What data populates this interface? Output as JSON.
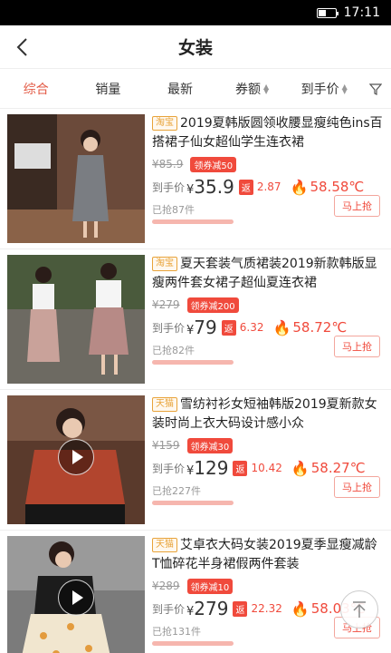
{
  "status": {
    "time": "17:11"
  },
  "header": {
    "title": "女装"
  },
  "sort": {
    "items": [
      "综合",
      "销量",
      "最新",
      "券额",
      "到手价"
    ],
    "active_color": "#e35a45"
  },
  "labels": {
    "arrival": "到手价",
    "rebate": "返",
    "grab": "马上抢",
    "currency": "¥"
  },
  "products": [
    {
      "tag": "淘宝",
      "title": "2019夏韩版圆领收腰显瘦纯色ins百搭裙子仙女超仙学生连衣裙",
      "orig_price": "¥85.9",
      "coupon": "领券减50",
      "price": "35.9",
      "rebate": "2.87",
      "percent": "58.58℃",
      "sold": "已抢87件",
      "video": false
    },
    {
      "tag": "淘宝",
      "title": "夏天套装气质裙装2019新款韩版显瘦两件套女裙子超仙夏连衣裙",
      "orig_price": "¥279",
      "coupon": "领券减200",
      "price": "79",
      "rebate": "6.32",
      "percent": "58.72℃",
      "sold": "已抢82件",
      "video": false
    },
    {
      "tag": "天猫",
      "title": "雪纺衬衫女短袖韩版2019夏新款女装时尚上衣大码设计感小众",
      "orig_price": "¥159",
      "coupon": "领券减30",
      "price": "129",
      "rebate": "10.42",
      "percent": "58.27℃",
      "sold": "已抢227件",
      "video": true
    },
    {
      "tag": "天猫",
      "title": "艾卓衣大码女装2019夏季显瘦减龄T恤碎花半身裙假两件套装",
      "orig_price": "¥289",
      "coupon": "领券减10",
      "price": "279",
      "rebate": "22.32",
      "percent": "58.03℃",
      "sold": "已抢131件",
      "video": true
    }
  ]
}
